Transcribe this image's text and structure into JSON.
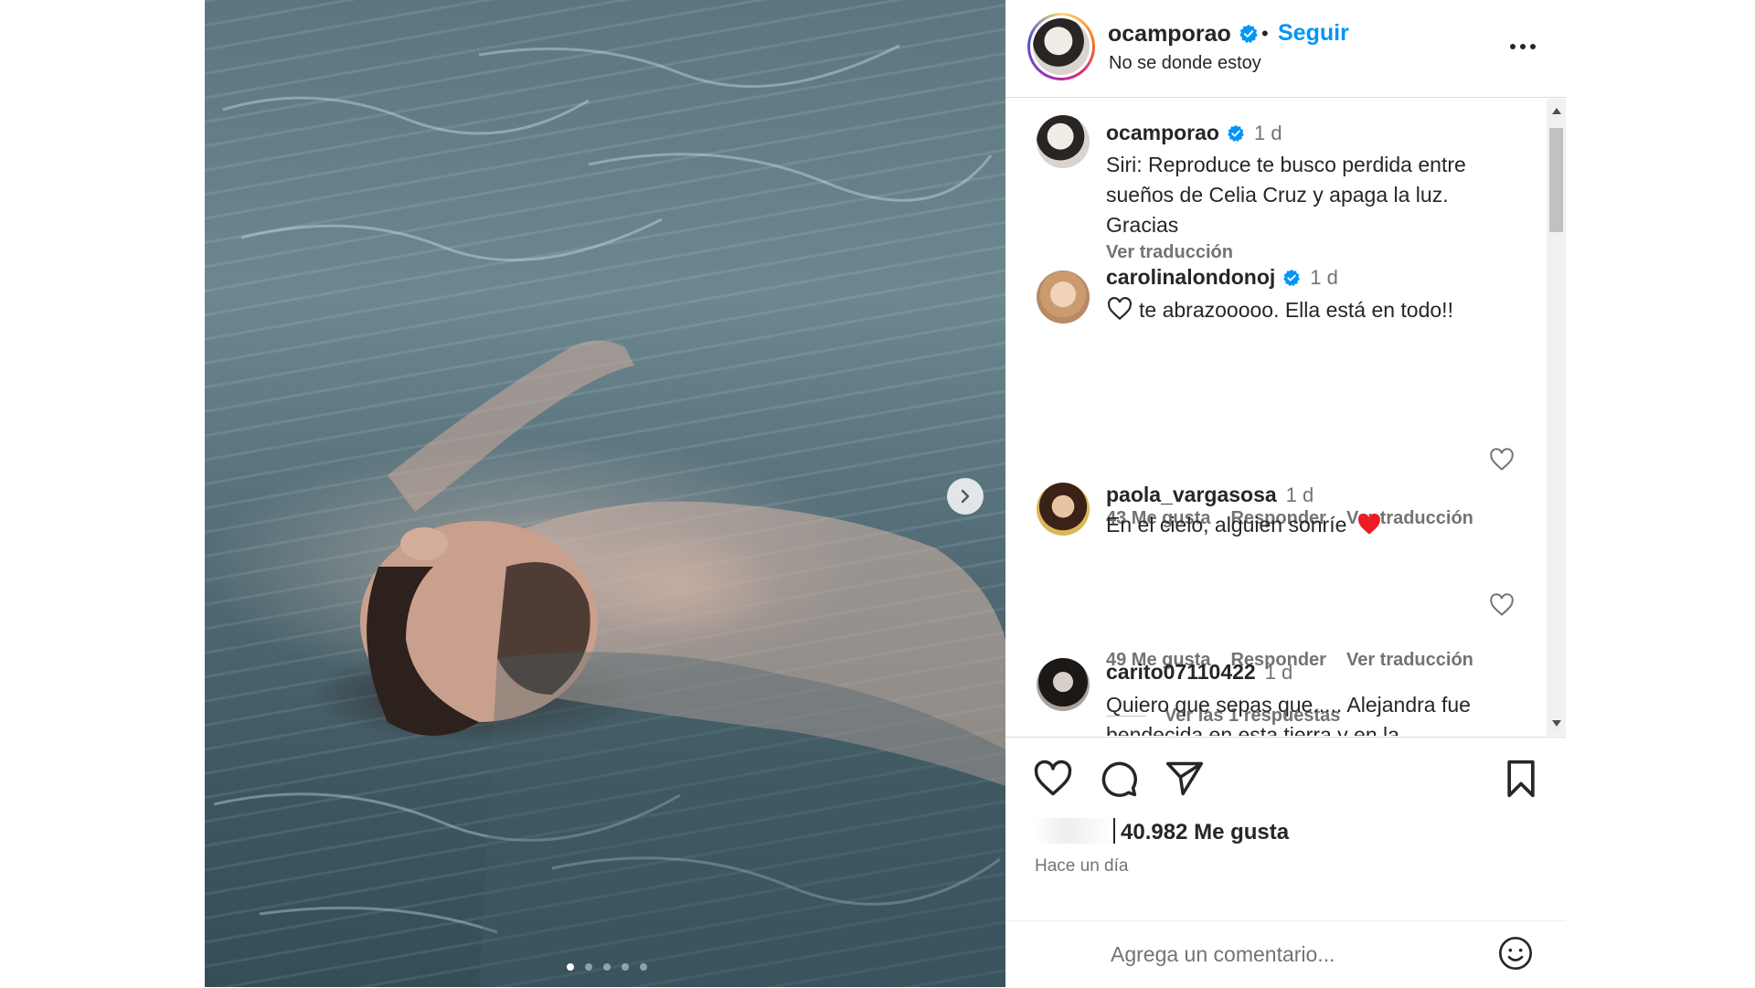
{
  "post": {
    "carousel_slide_count": 5,
    "carousel_active_index": 0
  },
  "header": {
    "username": "ocamporao",
    "separator": "•",
    "follow_label": "Seguir",
    "location": "No se donde estoy"
  },
  "comments": [
    {
      "username": "ocamporao",
      "time": "1 d",
      "verified": true,
      "text": "Siri: Reproduce te busco perdida entre sueños de Celia Cruz y apaga la luz. Gracias",
      "translate_label": "Ver traducción"
    },
    {
      "username": "carolinalondonoj",
      "time": "1 d",
      "verified": true,
      "text": "te abrazooooo. Ella está en todo!!",
      "likes": "43 Me gusta",
      "reply_label": "Responder",
      "translate_label": "Ver traducción"
    },
    {
      "username": "paola_vargasosa",
      "time": "1 d",
      "verified": false,
      "text": "En el cielo, alguien sonríe",
      "likes": "49 Me gusta",
      "reply_label": "Responder",
      "translate_label": "Ver traducción",
      "view_replies": "Ver las 1 respuestas"
    },
    {
      "username": "carito07110422",
      "time": "1 d",
      "verified": false,
      "text": "Quiero que sepas que..... Alejandra fue bendecida en esta tierra y en la"
    }
  ],
  "footer": {
    "likes_count": "40.982 Me gusta",
    "timestamp": "Hace un día",
    "comment_placeholder": "Agrega un comentario..."
  },
  "colors": {
    "accent": "#0095f6",
    "verified": "#0095f6",
    "heart_emoji": "#ed1c24",
    "muted_text": "#737373"
  }
}
